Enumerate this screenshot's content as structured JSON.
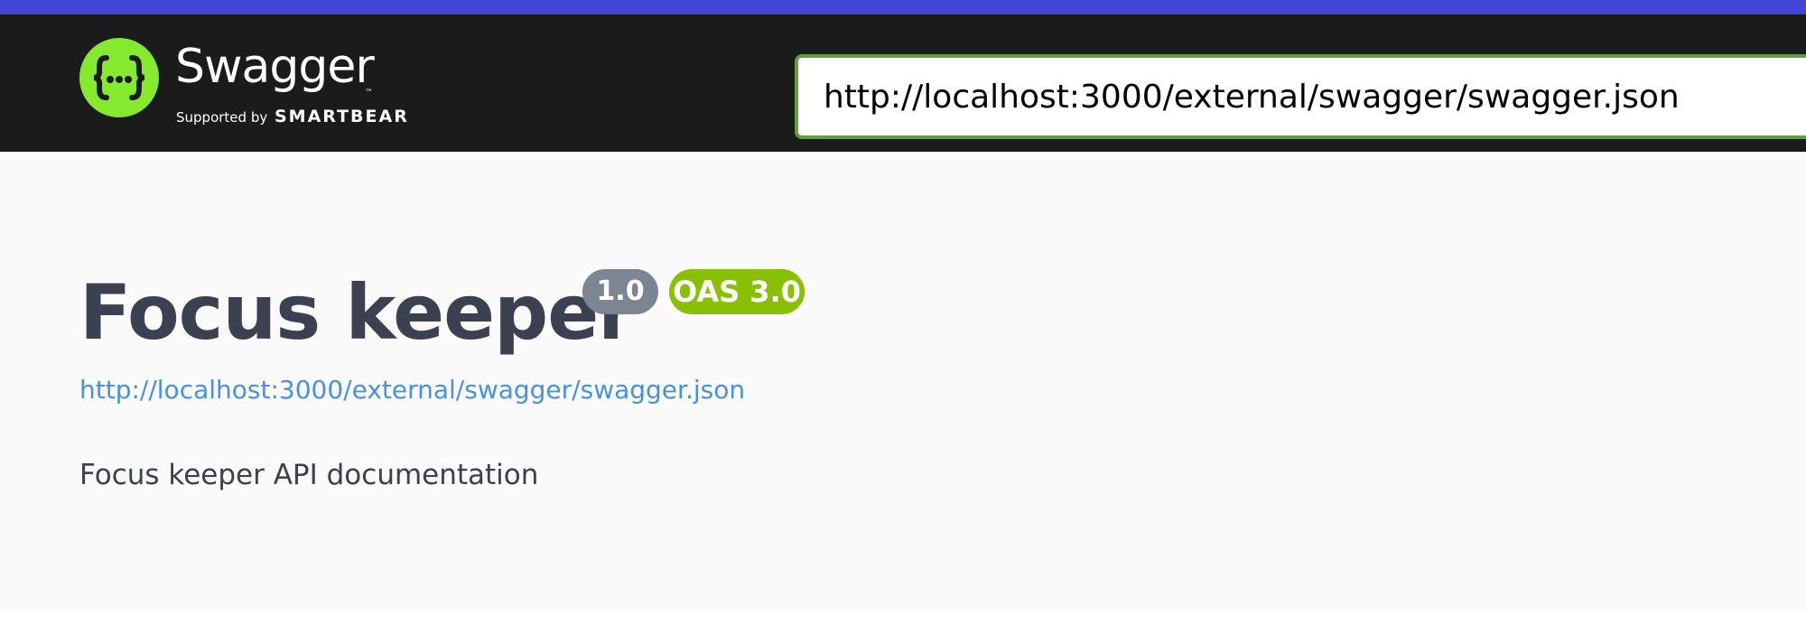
{
  "header": {
    "brand": {
      "name": "Swagger",
      "trademark": "™",
      "supported_by": "Supported by",
      "company": "SMARTBEAR"
    },
    "url_input": {
      "value": "http://localhost:3000/external/swagger/swagger.json"
    },
    "colors": {
      "stripe": "#4246d6",
      "bar": "#1b1b1b",
      "logo": "#85ea2d",
      "input_border": "#62a03f"
    }
  },
  "info": {
    "title": "Focus keeper",
    "version": "1.0",
    "oas_badge": "OAS 3.0",
    "spec_url": "http://localhost:3000/external/swagger/swagger.json",
    "description": "Focus keeper API documentation",
    "colors": {
      "title": "#3b4151",
      "version_badge": "#7d8492",
      "oas_badge": "#89bf04",
      "link": "#4990e2"
    }
  }
}
